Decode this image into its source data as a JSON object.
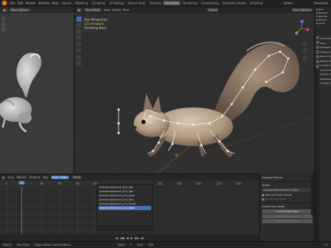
{
  "topbar": {
    "menus": [
      "File",
      "Edit",
      "Render",
      "Window",
      "Help"
    ],
    "tabs": [
      "Layout",
      "Modeling",
      "Sculpting",
      "UV Editing",
      "Texture Paint",
      "Shading",
      "Animation",
      "Rendering",
      "Compositing",
      "Geometry Nodes",
      "Scripting"
    ],
    "active_tab": "Animation",
    "scene": "Scene",
    "view_layer": "ViewLayer"
  },
  "left_viewport": {
    "header_label": "Pose Options"
  },
  "main_viewport": {
    "mode": "Pose Mode",
    "header_items": [
      "View",
      "Select",
      "Pose"
    ],
    "orientation": "Global",
    "pose_options": "Pose Options",
    "info_perspective": "User Perspective",
    "info_object": "(22) Armature",
    "info_sub": "Rendering Bone"
  },
  "outliner": {
    "items": [
      "Scene Collection",
      "Collection",
      "Armature",
      "Squirrel"
    ]
  },
  "properties": {
    "rows": [
      "Armature",
      "Pose",
      "Skeleton",
      "Viewport Display",
      "Bone Collections",
      "Motion Paths",
      "Custom Properties",
      "Inverse Kinematics",
      "Library Overrides",
      "Relations",
      "Custom Props"
    ]
  },
  "dope_sheet": {
    "header": [
      "View",
      "Marker",
      "Channel",
      "Key"
    ],
    "mode_button": "Push Down",
    "stash_button": "Stash",
    "ruler": [
      "0",
      "20",
      "40",
      "60",
      "80",
      "100"
    ],
    "current_frame": "22",
    "action_list": [
      "Armature|Squirrel_A13_Ball",
      "Armature|Squirrel_A13_Idle",
      "Armature|Squirrel_A13_Jump",
      "Armature|Squirrel_A13_Run",
      "Armature|Squirrel_A13_Smell",
      "Armature|Squirrel_A13_Walk"
    ],
    "selected_action": "Armature|Squirrel_A13_Walk",
    "nla_ruler": [
      "160",
      "180",
      "200",
      "220",
      "240"
    ]
  },
  "pose_panel": {
    "tab": "Selected Frames",
    "section_action": "Action",
    "action_field": "Armature|Squirrel_A13_Walk",
    "manual_frame_range": "Manual Frame Range",
    "cyclic": "Cyclic Animation",
    "create_section": "Create Pose Asset",
    "create_button": "Create Pose Asset",
    "copy_button": "Copy Pose as Asset",
    "paste_button": "Paste as New Asset"
  },
  "playback": {
    "controls": [
      "|◀",
      "◀◀",
      "◀",
      "▶",
      "▶▶",
      "▶|"
    ],
    "start_label": "Start",
    "start": "1",
    "end_label": "End",
    "end": "120"
  },
  "status": {
    "left": "Select",
    "mid": "Pan View",
    "right": "Dope Sheet Context Menu",
    "version": "4.1"
  },
  "colors": {
    "accent": "#4772b3",
    "selected_action_bg": "#4772b3",
    "object_info": "#e6c94a"
  }
}
